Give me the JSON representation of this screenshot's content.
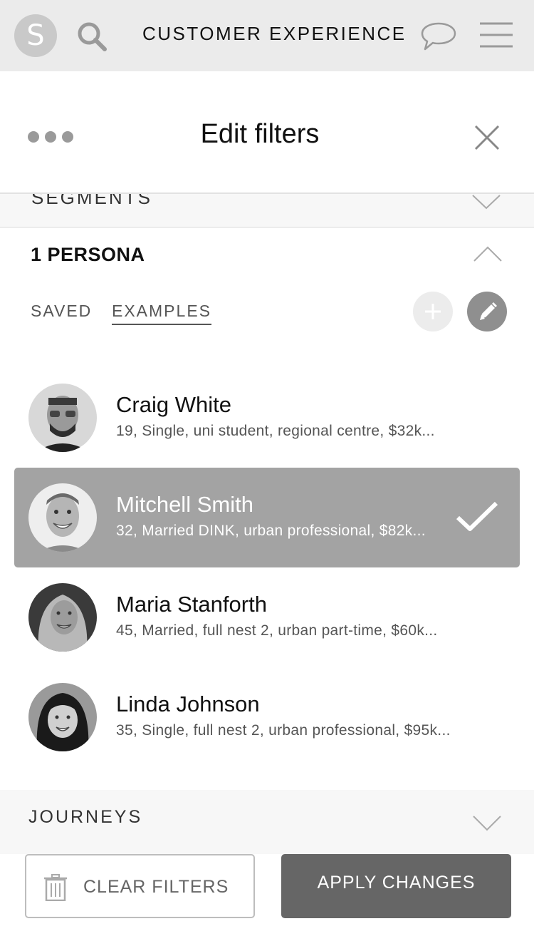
{
  "app": {
    "logo_letter": "S",
    "title": "CUSTOMER EXPERIENCE"
  },
  "header": {
    "title": "Edit filters"
  },
  "segments": {
    "label": "SEGMENTS"
  },
  "persona_section": {
    "title": "1 PERSONA",
    "tabs": [
      {
        "label": "SAVED",
        "active": false
      },
      {
        "label": "EXAMPLES",
        "active": true
      }
    ]
  },
  "personas": [
    {
      "name": "Craig White",
      "description": "19, Single, uni student, regional centre, $32k...",
      "selected": false
    },
    {
      "name": "Mitchell Smith",
      "description": "32, Married DINK, urban professional, $82k...",
      "selected": true
    },
    {
      "name": "Maria Stanforth",
      "description": "45, Married, full nest 2, urban part-time, $60k...",
      "selected": false
    },
    {
      "name": "Linda Johnson",
      "description": "35, Single, full nest 2, urban professional, $95k...",
      "selected": false
    }
  ],
  "journeys": {
    "label": "JOURNEYS"
  },
  "footer": {
    "clear_label": "CLEAR FILTERS",
    "apply_label": "APPLY CHANGES"
  },
  "icons": {
    "search": "search-icon",
    "chat": "chat-bubble-icon",
    "menu": "hamburger-menu-icon",
    "more": "more-dots-icon",
    "close": "close-icon",
    "chevron_up": "chevron-up-icon",
    "chevron_down": "chevron-down-icon",
    "add": "plus-icon",
    "edit": "pencil-icon",
    "check": "checkmark-icon",
    "trash": "trash-icon"
  },
  "colors": {
    "topbar": "#ebebeb",
    "selected_row": "#a3a3a3",
    "apply_button": "#666666"
  }
}
